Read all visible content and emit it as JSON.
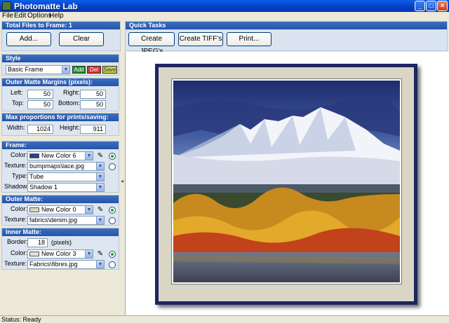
{
  "window": {
    "title": "Photomatte Lab",
    "minimize": "_",
    "maximize": "□",
    "close": "×"
  },
  "menu": [
    "File",
    "Edit",
    "Options",
    "Help"
  ],
  "files": {
    "header": "Total Files to Frame: 1",
    "add": "Add...",
    "clear": "Clear"
  },
  "quick_tasks": {
    "header": "Quick Tasks",
    "jpeg": "Create JPEG's",
    "tiff": "Create TIFF's",
    "print": "Print..."
  },
  "style": {
    "header": "Style",
    "value": "Basic Frame",
    "add": "Add",
    "del": "Del",
    "save": "Save"
  },
  "outer_matte_margins": {
    "header": "Outer Matte Margins (pixels):",
    "left_label": "Left:",
    "left": "50",
    "right_label": "Right:",
    "right": "50",
    "top_label": "Top:",
    "top": "50",
    "bottom_label": "Bottom:",
    "bottom": "50"
  },
  "max_proportions": {
    "header": "Max proportions for prints/saving:",
    "width_label": "Width:",
    "width": "1024",
    "height_label": "Height:",
    "height": "911"
  },
  "frame": {
    "header": "Frame:",
    "color_label": "Color:",
    "color": "New Color 6",
    "color_swatch": "#2B3F8F",
    "texture_label": "Texture:",
    "texture": "bumpmaps\\lace.jpg",
    "type_label": "Type:",
    "type": "Tube",
    "shadow_label": "Shadow:",
    "shadow": "Shadow 1"
  },
  "outer_matte": {
    "header": "Outer Matte:",
    "color_label": "Color:",
    "color": "New Color 0",
    "color_swatch": "#D9D6C6",
    "texture_label": "Texture:",
    "texture": "fabrics\\denim.jpg"
  },
  "inner_matte": {
    "header": "Inner Matte:",
    "border_label": "Border:",
    "border": "18",
    "border_unit": "(pixels)",
    "color_label": "Color:",
    "color": "New Color 3",
    "color_swatch": "#E4E2D8",
    "texture_label": "Texture:",
    "texture": "Fabrics\\fibres.jpg"
  },
  "icons": {
    "dropper": "eyedropper-icon",
    "dropdown": "chevron-down-icon",
    "splitter": "collapse-arrow-icon"
  },
  "status": "Status: Ready"
}
